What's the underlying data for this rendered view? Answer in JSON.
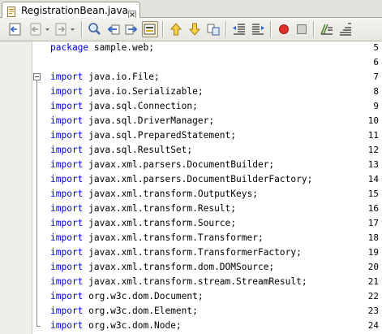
{
  "tab": {
    "title": "RegistrationBean.java",
    "file_icon": "java-file-icon",
    "close_icon": "close-icon"
  },
  "toolbar": {
    "buttons": [
      "last-edit-icon",
      "back-icon",
      "forward-icon",
      "find-icon",
      "find-previous-icon",
      "find-next-icon",
      "toggle-highlight-icon",
      "previous-bookmark-icon",
      "next-bookmark-icon",
      "toggle-bookmark-icon",
      "shift-left-icon",
      "shift-right-icon",
      "start-macro-icon",
      "stop-macro-icon",
      "comment-icon",
      "uncomment-icon"
    ]
  },
  "colors": {
    "keyword": "#0000e6",
    "gutter": "#efeeea",
    "tab_bar": "#e4e2dc"
  },
  "editor": {
    "lines": [
      {
        "number": "5",
        "keyword": "package",
        "rest": " sample.web;"
      },
      {
        "number": "6",
        "keyword": "",
        "rest": ""
      },
      {
        "number": "7",
        "keyword": "import",
        "rest": " java.io.File;"
      },
      {
        "number": "8",
        "keyword": "import",
        "rest": " java.io.Serializable;"
      },
      {
        "number": "9",
        "keyword": "import",
        "rest": " java.sql.Connection;"
      },
      {
        "number": "10",
        "keyword": "import",
        "rest": " java.sql.DriverManager;"
      },
      {
        "number": "11",
        "keyword": "import",
        "rest": " java.sql.PreparedStatement;"
      },
      {
        "number": "12",
        "keyword": "import",
        "rest": " java.sql.ResultSet;"
      },
      {
        "number": "13",
        "keyword": "import",
        "rest": " javax.xml.parsers.DocumentBuilder;"
      },
      {
        "number": "14",
        "keyword": "import",
        "rest": " javax.xml.parsers.DocumentBuilderFactory;"
      },
      {
        "number": "15",
        "keyword": "import",
        "rest": " javax.xml.transform.OutputKeys;"
      },
      {
        "number": "16",
        "keyword": "import",
        "rest": " javax.xml.transform.Result;"
      },
      {
        "number": "17",
        "keyword": "import",
        "rest": " javax.xml.transform.Source;"
      },
      {
        "number": "18",
        "keyword": "import",
        "rest": " javax.xml.transform.Transformer;"
      },
      {
        "number": "19",
        "keyword": "import",
        "rest": " javax.xml.transform.TransformerFactory;"
      },
      {
        "number": "20",
        "keyword": "import",
        "rest": " javax.xml.transform.dom.DOMSource;"
      },
      {
        "number": "21",
        "keyword": "import",
        "rest": " javax.xml.transform.stream.StreamResult;"
      },
      {
        "number": "22",
        "keyword": "import",
        "rest": " org.w3c.dom.Document;"
      },
      {
        "number": "23",
        "keyword": "import",
        "rest": " org.w3c.dom.Element;"
      },
      {
        "number": "24",
        "keyword": "import",
        "rest": " org.w3c.dom.Node;"
      }
    ]
  }
}
